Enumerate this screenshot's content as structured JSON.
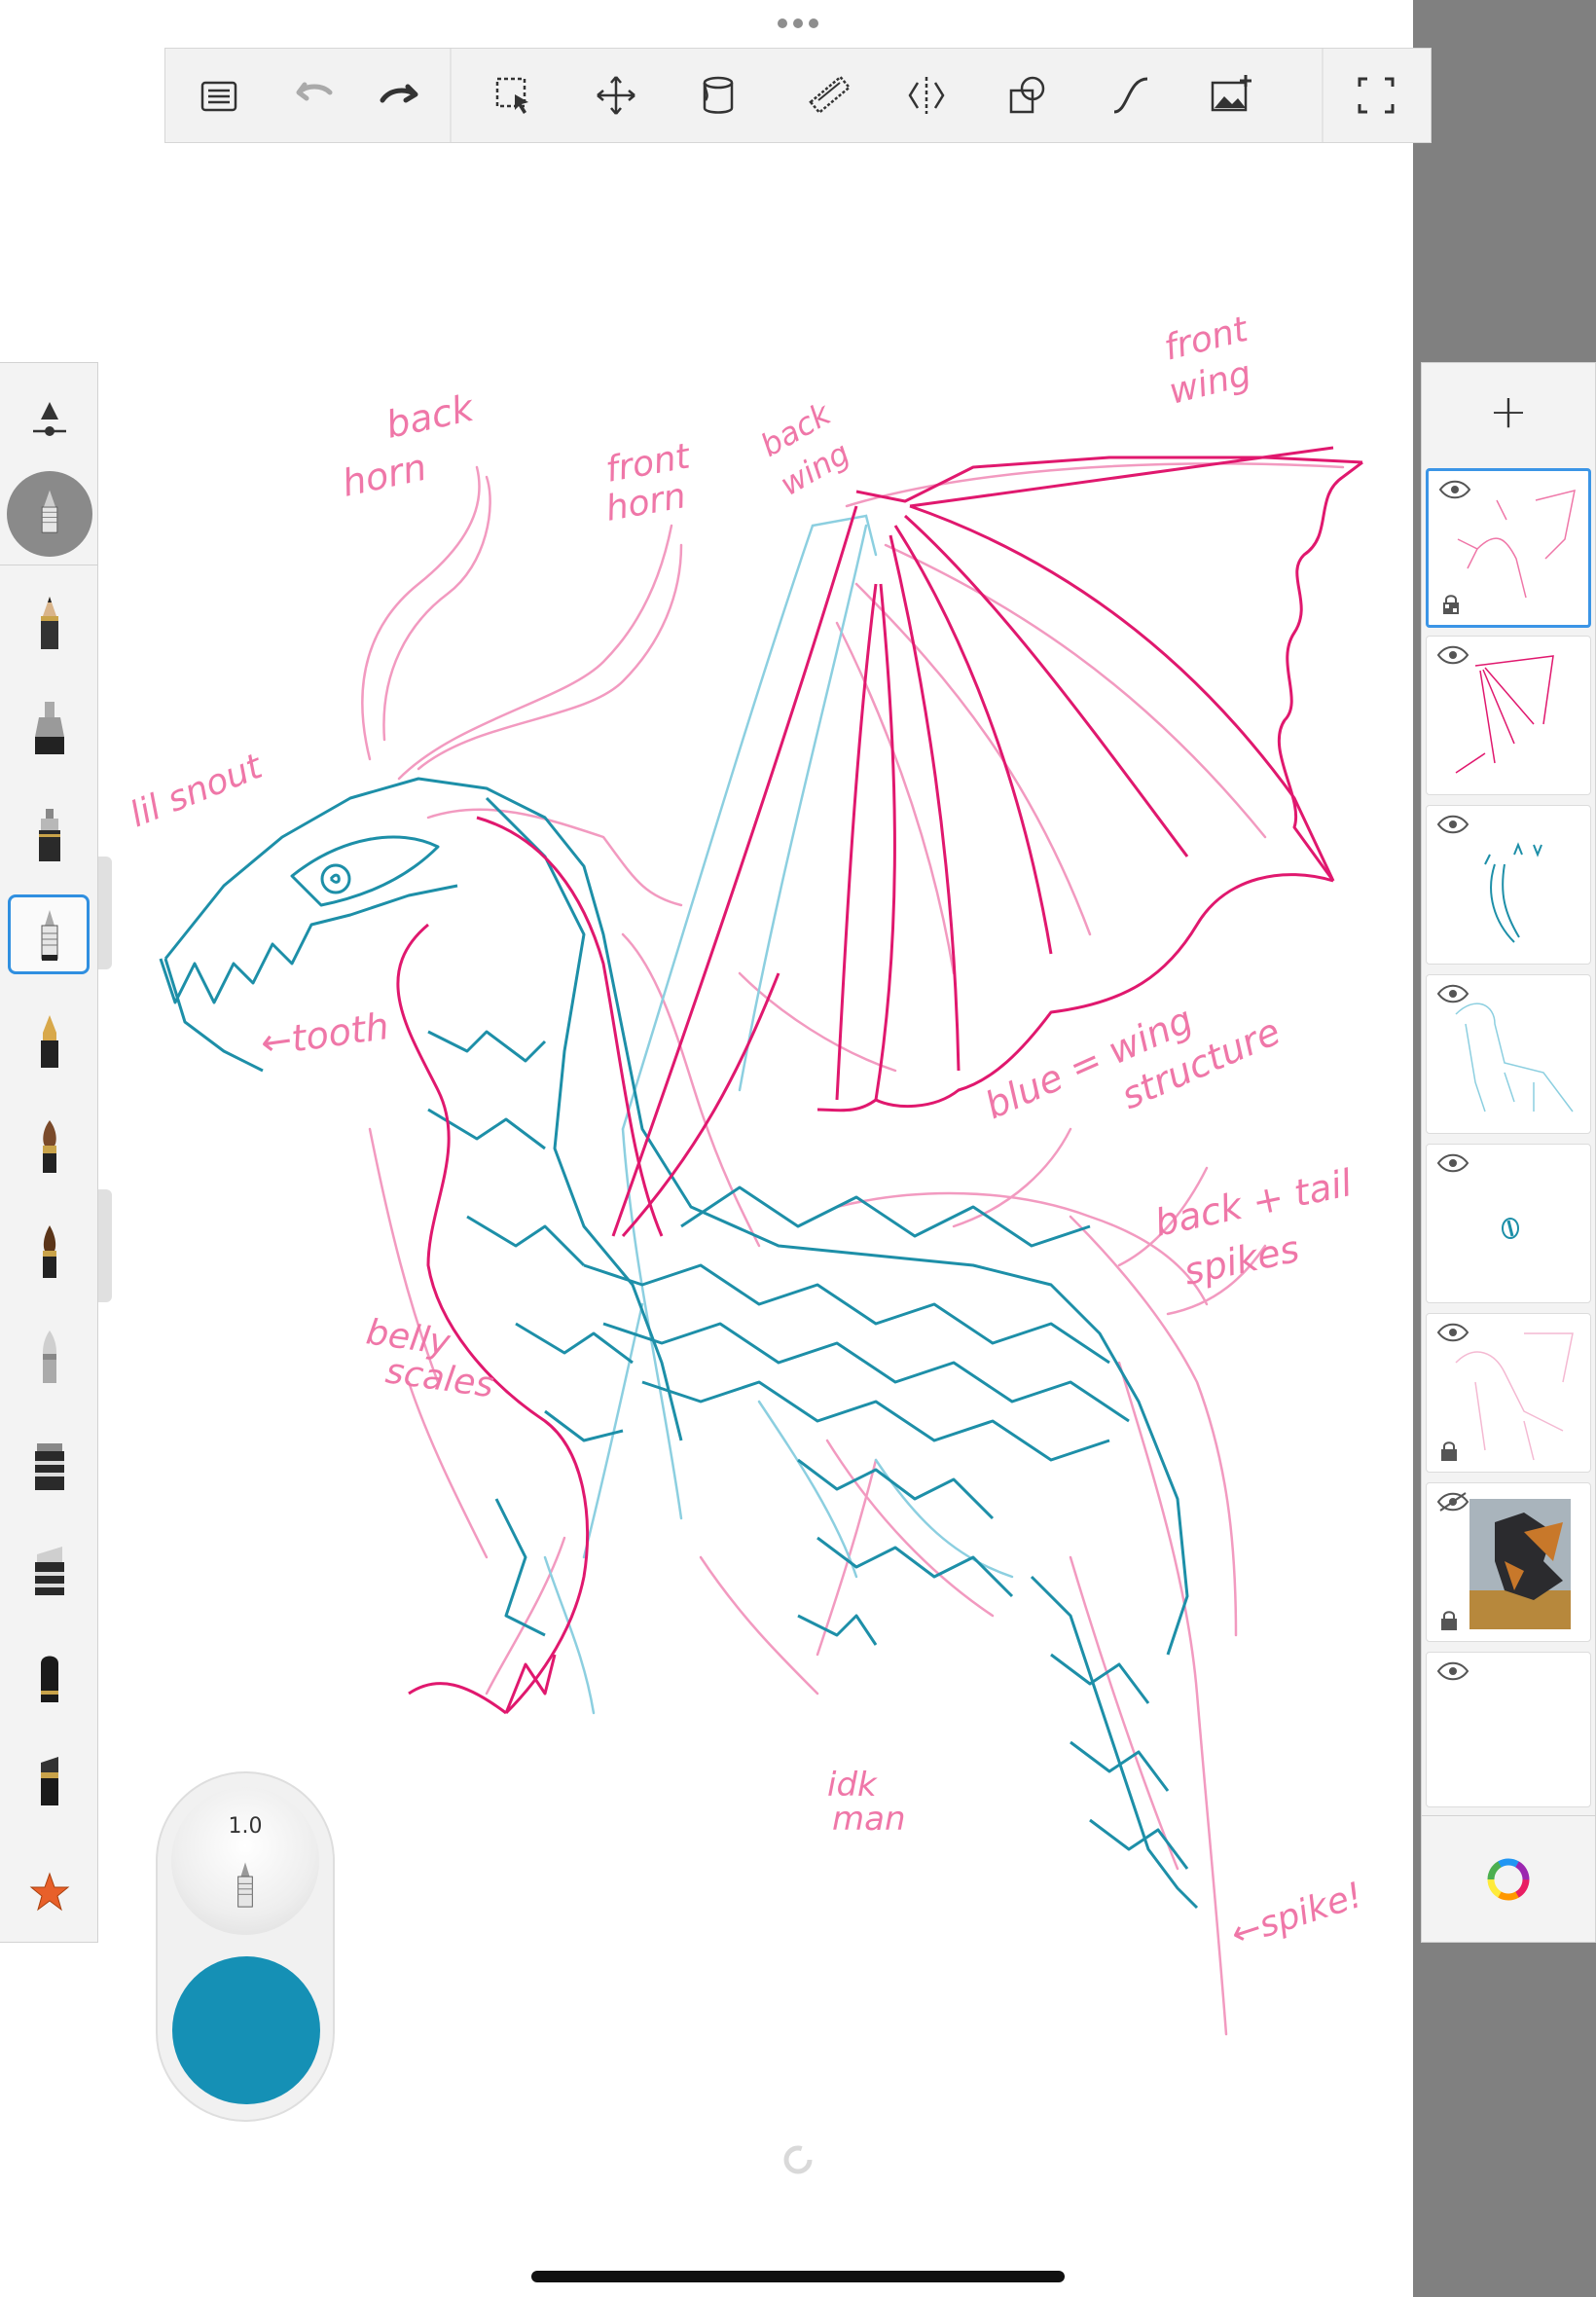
{
  "toolbar": {
    "buttons": [
      {
        "name": "layers-list",
        "icon": "list-icon"
      },
      {
        "name": "undo",
        "icon": "undo-icon"
      },
      {
        "name": "redo",
        "icon": "redo-icon"
      },
      {
        "name": "selection",
        "icon": "selection-icon"
      },
      {
        "name": "transform",
        "icon": "move-icon"
      },
      {
        "name": "fill",
        "icon": "paint-bucket-icon"
      },
      {
        "name": "ruler",
        "icon": "ruler-icon"
      },
      {
        "name": "symmetry",
        "icon": "symmetry-icon"
      },
      {
        "name": "shapes",
        "icon": "shapes-icon"
      },
      {
        "name": "curve",
        "icon": "curve-icon"
      },
      {
        "name": "add-image",
        "icon": "add-image-icon"
      },
      {
        "name": "fullscreen",
        "icon": "fullscreen-icon"
      }
    ]
  },
  "brush_palette": {
    "items": [
      "brush-properties-icon",
      "pencil-icon",
      "marker-icon",
      "ink-pen-icon",
      "technical-pen-icon",
      "fountain-pen-icon",
      "paintbrush-icon",
      "dark-brush-icon",
      "airbrush-icon",
      "stamp-icon",
      "eraser-icon",
      "chisel-icon",
      "flat-brush-icon",
      "favorites-star-icon"
    ],
    "selected_index": 5
  },
  "puck": {
    "size_label": "1.0",
    "color": "#1590b5"
  },
  "layers": {
    "add_label": "+",
    "items": [
      {
        "visible": true,
        "locked": false,
        "selected": true
      },
      {
        "visible": true,
        "locked": false,
        "selected": false
      },
      {
        "visible": true,
        "locked": false,
        "selected": false
      },
      {
        "visible": true,
        "locked": false,
        "selected": false
      },
      {
        "visible": true,
        "locked": false,
        "selected": false
      },
      {
        "visible": true,
        "locked": true,
        "selected": false
      },
      {
        "visible": false,
        "locked": true,
        "selected": false
      },
      {
        "visible": true,
        "locked": false,
        "selected": false
      }
    ]
  },
  "annotations": {
    "back_horn": "back",
    "back_horn_2": "horn",
    "front_horn": "front",
    "front_horn_2": "horn",
    "back_wing": "back",
    "back_wing_2": "wing",
    "front_wing": "front",
    "front_wing_2": "wing",
    "lil_snout": "lil snout",
    "tooth": "←tooth",
    "blue_wing": "blue = wing",
    "blue_wing_2": "structure",
    "back_tail": "back + tail",
    "back_tail_2": "spikes",
    "belly": "belly",
    "belly_2": "scales",
    "idk": "idk",
    "idk_2": "man",
    "spike": "←spike!"
  },
  "colors": {
    "sketch_pink": "#ef77a8",
    "line_magenta": "#e0186e",
    "line_teal": "#1d8fa8",
    "light_blue": "#8ccfe0",
    "selection_blue": "#2f8fe0"
  }
}
